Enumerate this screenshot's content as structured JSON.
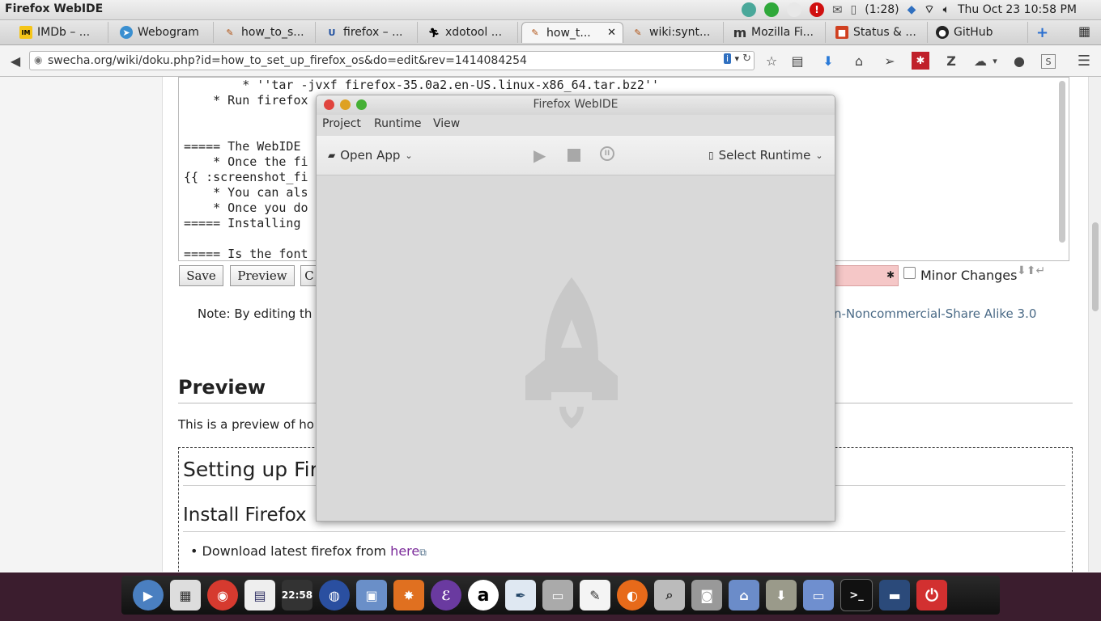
{
  "topbar": {
    "window_title": "Firefox WebIDE",
    "battery": "(1:28)",
    "datetime": "Thu Oct 23  10:58 PM"
  },
  "tabs": [
    {
      "label": "IMDb – ...",
      "icon": "imdb-icon"
    },
    {
      "label": "Webogram",
      "icon": "telegram-icon"
    },
    {
      "label": "how_to_s...",
      "icon": "wiki-icon"
    },
    {
      "label": "firefox – ...",
      "icon": "u-icon"
    },
    {
      "label": "xdotool ...",
      "icon": "xdotool-icon"
    },
    {
      "label": "how_t...",
      "icon": "wiki-icon",
      "active": true
    },
    {
      "label": "wiki:synt...",
      "icon": "wiki-icon"
    },
    {
      "label": "Mozilla Fi...",
      "icon": "m-icon"
    },
    {
      "label": "Status & ...",
      "icon": "status-icon"
    },
    {
      "label": "GitHub",
      "icon": "github-icon"
    }
  ],
  "url": "swecha.org/wiki/doku.php?id=how_to_set_up_firefox_os&do=edit&rev=1414084254",
  "editor": {
    "lines": [
      "        * ''tar -jvxf firefox-35.0a2.en-US.linux-x86_64.tar.bz2''",
      "    * Run firefox",
      "",
      "===== The WebIDE",
      "    * Once the fi",
      "{{ :screenshot_fi",
      "    * You can als",
      "    * Once you do",
      "===== Installing",
      "",
      "===== Is the font"
    ]
  },
  "form": {
    "save": "Save",
    "preview": "Preview",
    "cancel": "C",
    "minor_changes": "Minor Changes"
  },
  "note": {
    "left": "Note: By editing th",
    "right": "n-Noncommercial-Share Alike 3.0"
  },
  "preview": {
    "heading": "Preview",
    "intro": "This is a preview of ho",
    "h_setup": "Setting up Fir",
    "h_install": "Install Firefox",
    "bullet_text": "Download latest firefox from ",
    "bullet_link": "here"
  },
  "webide": {
    "title": "Firefox WebIDE",
    "menu": [
      "Project",
      "Runtime",
      "View"
    ],
    "open_app": "Open App",
    "select_runtime": "Select Runtime"
  },
  "dock": {
    "clock": "22:58"
  },
  "colors": {
    "dock_bg": "#3b1d2e",
    "link": "#4a6a86",
    "close": "#e0443e",
    "minimize": "#dea123",
    "maximize": "#45b035"
  }
}
